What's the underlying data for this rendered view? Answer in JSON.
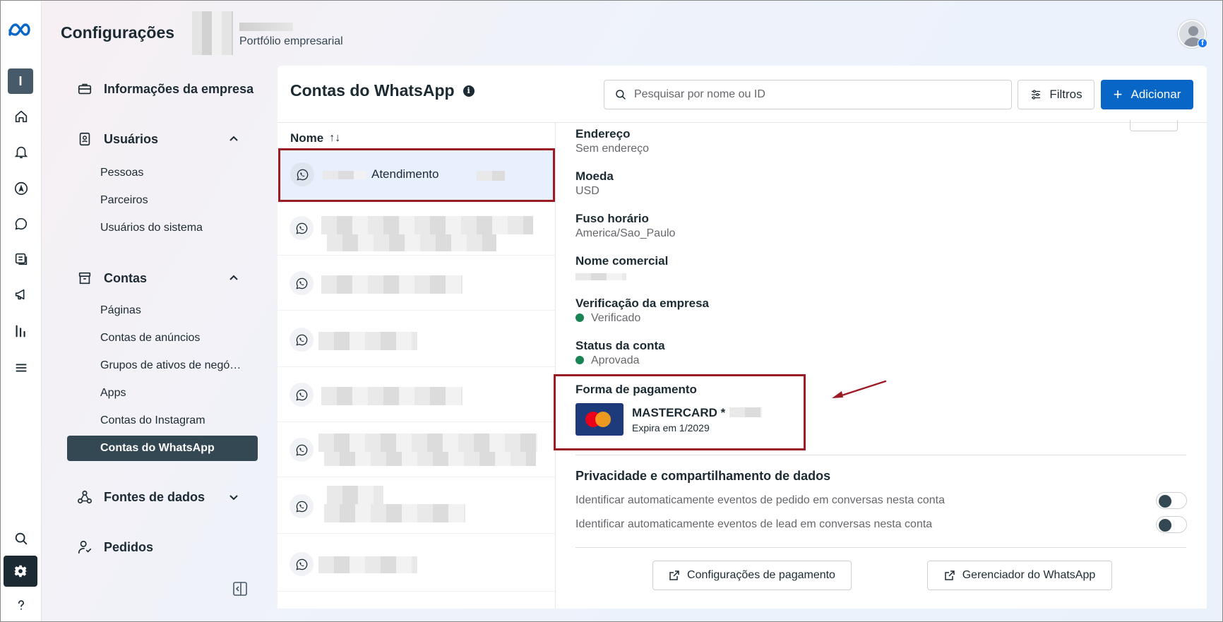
{
  "header": {
    "title": "Configurações",
    "portfolio_subtitle": "Portfólio empresarial"
  },
  "rail": {
    "avatar_letter": "I"
  },
  "sidebar": {
    "company_info": "Informações da empresa",
    "users": {
      "label": "Usuários",
      "items": [
        "Pessoas",
        "Parceiros",
        "Usuários do sistema"
      ]
    },
    "accounts": {
      "label": "Contas",
      "items": [
        "Páginas",
        "Contas de anúncios",
        "Grupos de ativos de negó…",
        "Apps",
        "Contas do Instagram",
        "Contas do WhatsApp"
      ],
      "active": "Contas do WhatsApp"
    },
    "data_sources": "Fontes de dados",
    "orders": "Pedidos"
  },
  "panel": {
    "title": "Contas do WhatsApp",
    "search_placeholder": "Pesquisar por nome ou ID",
    "filter_label": "Filtros",
    "add_label": "Adicionar",
    "list_header": "Nome",
    "sort_glyph": "↑↓",
    "selected_account": "Atendimento"
  },
  "details": {
    "address_label": "Endereço",
    "address_value": "Sem endereço",
    "currency_label": "Moeda",
    "currency_value": "USD",
    "timezone_label": "Fuso horário",
    "timezone_value": "America/Sao_Paulo",
    "trade_name_label": "Nome comercial",
    "verification_label": "Verificação da empresa",
    "verification_value": "Verificado",
    "account_status_label": "Status da conta",
    "account_status_value": "Aprovada",
    "payment_label": "Forma de pagamento",
    "card_name": "MASTERCARD *",
    "card_expiry": "Expira em 1/2029",
    "privacy_title": "Privacidade e compartilhamento de dados",
    "toggle_orders": "Identificar automaticamente eventos de pedido em conversas nesta conta",
    "toggle_leads": "Identificar automaticamente eventos de lead em conversas nesta conta",
    "payment_settings_btn": "Configurações de pagamento",
    "whatsapp_manager_btn": "Gerenciador do WhatsApp"
  },
  "colors": {
    "primary": "#0866c6",
    "sidebar_active": "#344854",
    "status_green": "#188454",
    "highlight_red": "#9b1c24"
  }
}
